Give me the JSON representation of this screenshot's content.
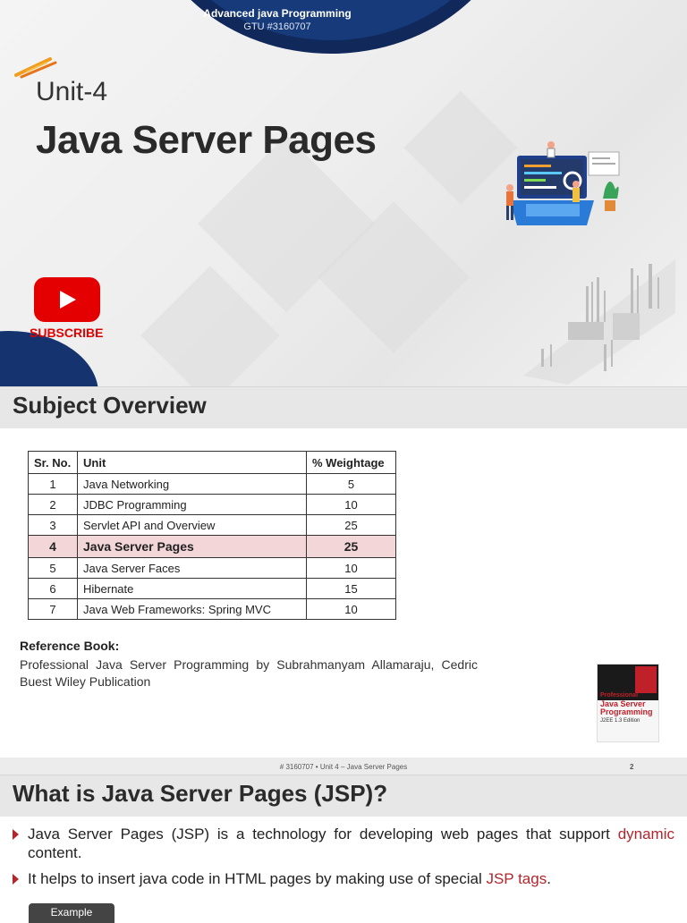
{
  "slide1": {
    "course_title": "Advanced java Programming",
    "course_code": "GTU #3160707",
    "unit_label": "Unit-4",
    "main_title": "Java Server Pages",
    "subscribe_label": "SUBSCRIBE",
    "colors": {
      "navy": "#15346f",
      "youtube_red": "#e40000"
    }
  },
  "slide2": {
    "section_title": "Subject Overview",
    "table": {
      "headers": [
        "Sr. No.",
        "Unit",
        "% Weightage"
      ],
      "rows": [
        {
          "no": "1",
          "unit": "Java Networking",
          "weight": "5"
        },
        {
          "no": "2",
          "unit": "JDBC Programming",
          "weight": "10"
        },
        {
          "no": "3",
          "unit": "Servlet API and Overview",
          "weight": "25"
        },
        {
          "no": "4",
          "unit": "Java Server Pages",
          "weight": "25",
          "highlight": true
        },
        {
          "no": "5",
          "unit": "Java Server Faces",
          "weight": "10"
        },
        {
          "no": "6",
          "unit": "Hibernate",
          "weight": "15"
        },
        {
          "no": "7",
          "unit": "Java Web Frameworks: Spring MVC",
          "weight": "10"
        }
      ]
    },
    "reference_heading": "Reference Book:",
    "reference_text": "Professional Java Server Programming by Subrahmanyam Allamaraju, Cedric Buest Wiley Publication",
    "book_cover": {
      "line1": "Professional",
      "line2": "Java Server Programming",
      "line3": "J2EE 1.3 Edition"
    },
    "footer_text": "# 3160707  •  Unit 4 – Java Server Pages",
    "page_number": "2"
  },
  "slide3": {
    "section_title": "What is Java Server Pages (JSP)?",
    "bullet1_pre": "Java Server Pages (JSP) is a technology for developing web pages that support ",
    "bullet1_accent": "dynamic",
    "bullet1_post": " content.",
    "bullet2_pre": "It helps to insert java code in HTML pages by making use of special ",
    "bullet2_accent": "JSP tags",
    "bullet2_post": ".",
    "example_label": "Example",
    "accent_color": "#b3262b"
  }
}
